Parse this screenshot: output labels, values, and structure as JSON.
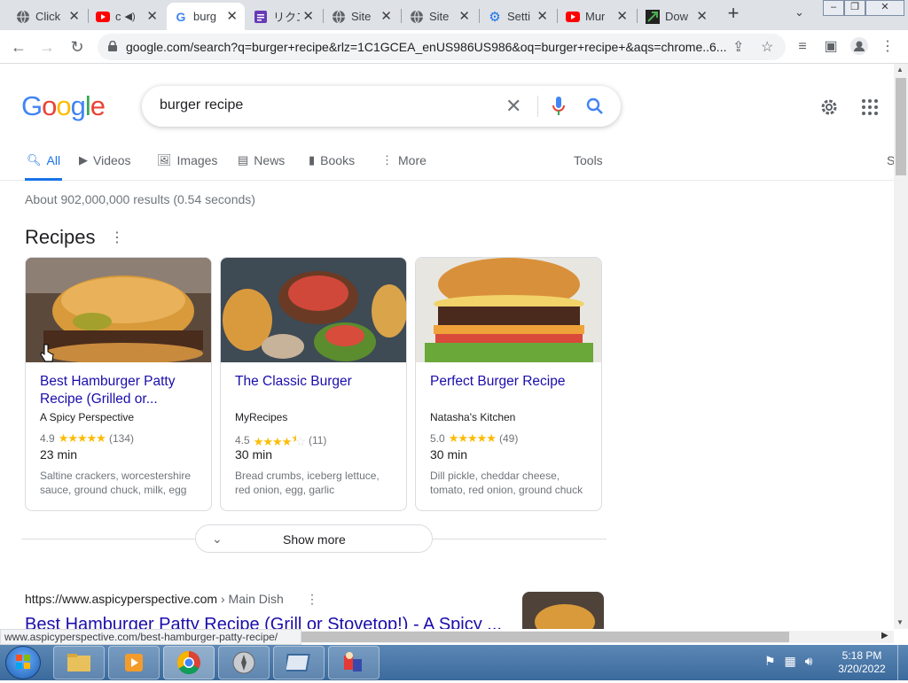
{
  "browser": {
    "tabs": [
      {
        "title": "Click",
        "icon": "globe-icon",
        "active": false
      },
      {
        "title": "c",
        "icon": "youtube-icon",
        "active": false,
        "audio": true
      },
      {
        "title": "burg",
        "icon": "google-g-icon",
        "active": true
      },
      {
        "title": "リクエ",
        "icon": "forms-icon",
        "active": false
      },
      {
        "title": "Site",
        "icon": "globe-icon",
        "active": false
      },
      {
        "title": "Site",
        "icon": "globe-icon",
        "active": false
      },
      {
        "title": "Setti",
        "icon": "settings-gear-icon",
        "active": false
      },
      {
        "title": "Mur",
        "icon": "youtube-icon",
        "active": false
      },
      {
        "title": "Dow",
        "icon": "download-site-icon",
        "active": false
      }
    ],
    "url": "google.com/search?q=burger+recipe&rlz=1C1GCEA_enUS986US986&oq=burger+recipe+&aqs=chrome..6...",
    "status_url": "www.aspicyperspective.com/best-hamburger-patty-recipe/"
  },
  "search": {
    "query": "burger recipe",
    "tabs": [
      {
        "label": "All",
        "icon": "search-icon",
        "active": true
      },
      {
        "label": "Videos",
        "icon": "video-icon"
      },
      {
        "label": "Images",
        "icon": "image-icon"
      },
      {
        "label": "News",
        "icon": "news-icon"
      },
      {
        "label": "Books",
        "icon": "book-icon"
      },
      {
        "label": "More",
        "icon": "more-vert-icon"
      }
    ],
    "tools_label": "Tools",
    "cut_label": "S",
    "stats": "About 902,000,000 results (0.54 seconds)"
  },
  "recipes": {
    "heading": "Recipes",
    "cards": [
      {
        "title": "Best Hamburger Patty Recipe (Grilled or...",
        "source": "A Spicy Perspective",
        "rating": "4.9",
        "stars": 5,
        "reviews": "(134)",
        "time": "23 min",
        "ingredients": "Saltine crackers, worcestershire sauce, ground chuck, milk, egg"
      },
      {
        "title": "The Classic Burger",
        "source": "MyRecipes",
        "rating": "4.5",
        "stars": 4.5,
        "reviews": "(11)",
        "time": "30 min",
        "ingredients": "Bread crumbs, iceberg lettuce, red onion, egg, garlic"
      },
      {
        "title": "Perfect Burger Recipe",
        "source": "Natasha's Kitchen",
        "rating": "5.0",
        "stars": 5,
        "reviews": "(49)",
        "time": "30 min",
        "ingredients": "Dill pickle, cheddar cheese, tomato, red onion, ground chuck"
      }
    ],
    "show_more": "Show more"
  },
  "result": {
    "url": "https://www.aspicyperspective.com",
    "breadcrumb": "› Main Dish",
    "title": "Best Hamburger Patty Recipe (Grill or Stovetop!) - A Spicy ..."
  },
  "taskbar": {
    "time": "5:18 PM",
    "date": "3/20/2022"
  },
  "colors": {
    "link": "#1a0dab",
    "accent": "#1a73e8",
    "star": "#fbbc04"
  }
}
